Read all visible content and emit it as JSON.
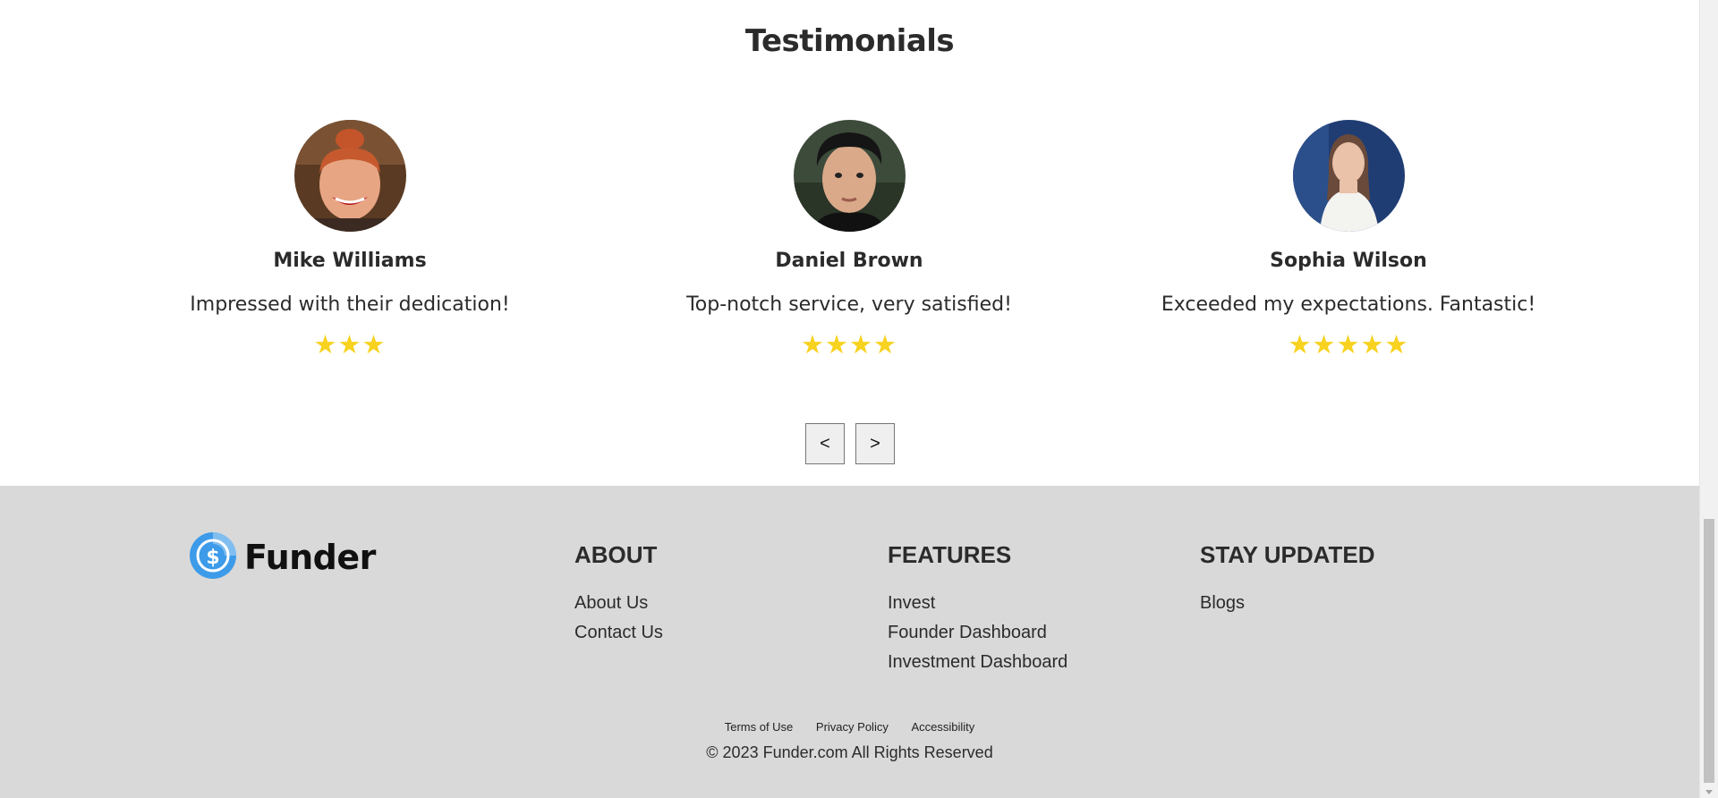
{
  "testimonials": {
    "title": "Testimonials",
    "items": [
      {
        "name": "Mike Williams",
        "quote": "Impressed with their dedication!",
        "rating": 3,
        "stars": "★★★"
      },
      {
        "name": "Daniel Brown",
        "quote": "Top-notch service, very satisfied!",
        "rating": 4,
        "stars": "★★★★"
      },
      {
        "name": "Sophia Wilson",
        "quote": "Exceeded my expectations. Fantastic!",
        "rating": 5,
        "stars": "★★★★★"
      }
    ],
    "prev_label": "<",
    "next_label": ">"
  },
  "footer": {
    "brand": "Funder",
    "columns": [
      {
        "title": "ABOUT",
        "links": [
          "About Us",
          "Contact Us"
        ]
      },
      {
        "title": "FEATURES",
        "links": [
          "Invest",
          "Founder Dashboard",
          "Investment Dashboard"
        ]
      },
      {
        "title": "STAY UPDATED",
        "links": [
          "Blogs"
        ]
      }
    ],
    "legal_links": [
      "Terms of Use",
      "Privacy Policy",
      "Accessibility"
    ],
    "copyright": "© 2023 Funder.com All Rights Reserved"
  },
  "colors": {
    "star": "#f7d21e",
    "footer_bg": "#d9d9d9",
    "logo_blue": "#3d9be9"
  },
  "icons": {
    "logo": "dollar-coin-icon"
  }
}
